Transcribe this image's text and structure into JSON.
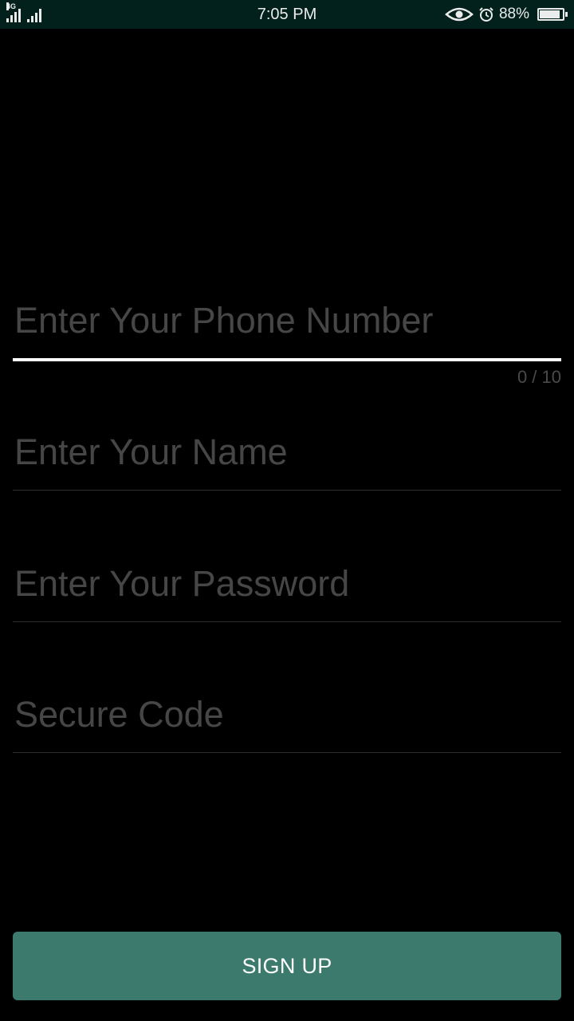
{
  "status_bar": {
    "network": "4G",
    "time": "7:05 PM",
    "battery_percent": "88%",
    "battery_level": 0.88,
    "icons": [
      "signal-4g-icon",
      "signal-icon",
      "eye-comfort-icon",
      "alarm-icon",
      "battery-icon"
    ]
  },
  "form": {
    "phone": {
      "placeholder": "Enter Your Phone Number",
      "value": "",
      "counter": "0 / 10"
    },
    "name": {
      "placeholder": "Enter Your Name",
      "value": ""
    },
    "password": {
      "placeholder": "Enter Your Password",
      "value": ""
    },
    "secure_code": {
      "placeholder": "Secure Code",
      "value": ""
    }
  },
  "signup_button": {
    "label": "SIGN UP"
  },
  "colors": {
    "status_bar_bg": "#03211c",
    "background": "#000000",
    "button_bg": "#3b7a6c",
    "placeholder": "#464646",
    "active_underline": "#ffffff"
  }
}
